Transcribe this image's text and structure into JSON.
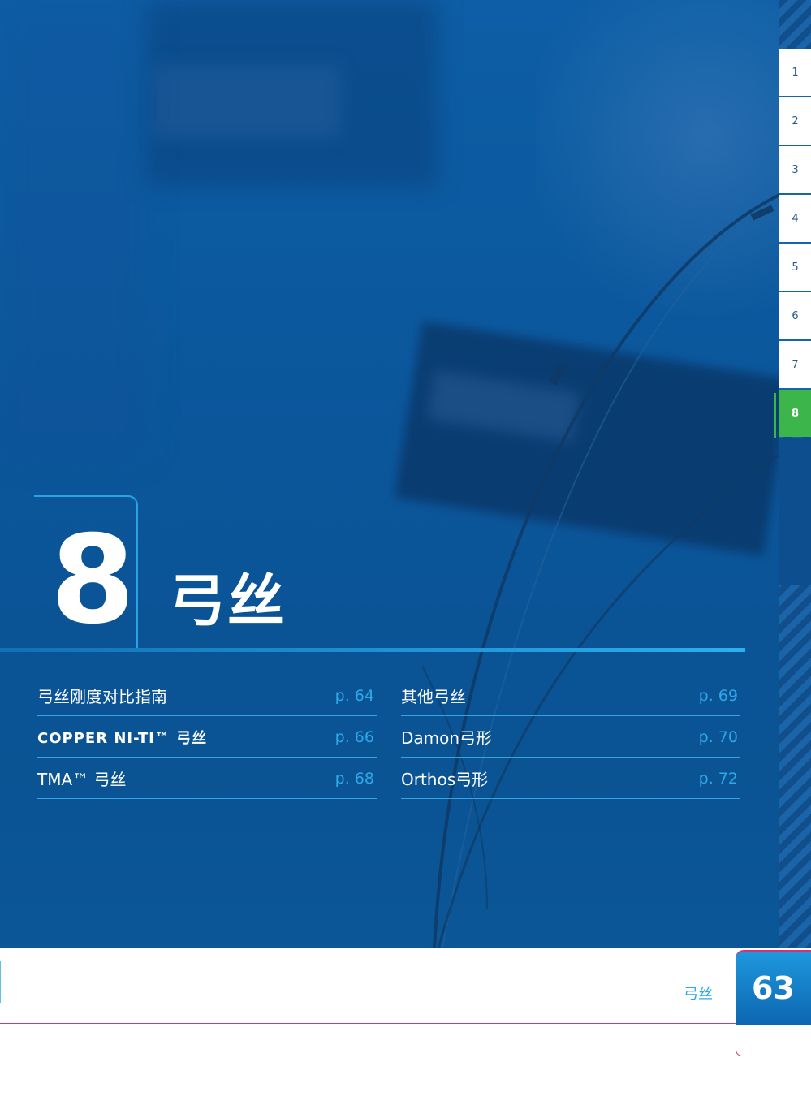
{
  "chapter": {
    "number": "8",
    "title": "弓丝"
  },
  "toc": {
    "left": [
      {
        "label": "弓丝刚度对比指南",
        "page": "p. 64"
      },
      {
        "label": "COPPER NI-TI™ 弓丝",
        "page": "p. 66"
      },
      {
        "label": "TMA™ 弓丝",
        "page": "p. 68"
      }
    ],
    "right": [
      {
        "label": "其他弓丝",
        "page": "p. 69"
      },
      {
        "label": "Damon弓形",
        "page": "p. 70"
      },
      {
        "label": "Orthos弓形",
        "page": "p. 72"
      }
    ]
  },
  "side_tabs": [
    "1",
    "2",
    "3",
    "4",
    "5",
    "6",
    "7",
    "8"
  ],
  "active_tab": "8",
  "footer": {
    "section_label": "弓丝",
    "page_number": "63"
  },
  "colors": {
    "hero_blue": "#0b569b",
    "accent_cyan": "#2da8e8",
    "active_tab_green": "#3cb54a",
    "footer_rule_magenta": "#c93a6d"
  }
}
